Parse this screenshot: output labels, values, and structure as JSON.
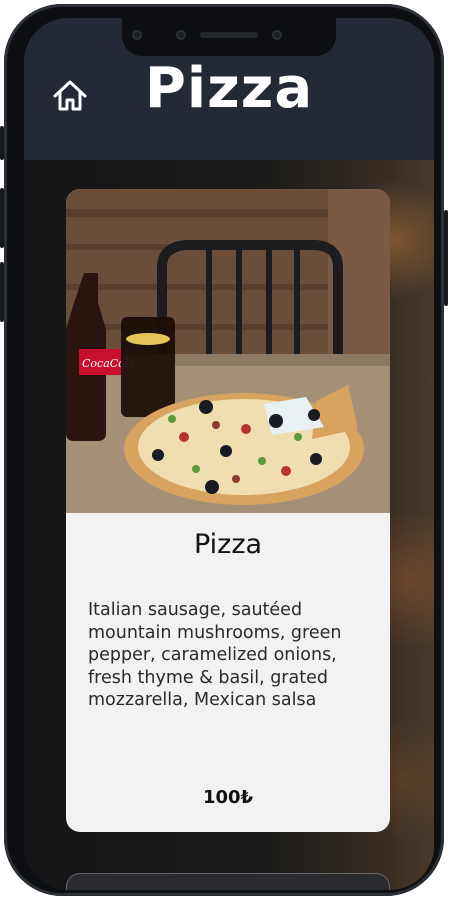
{
  "header": {
    "title": "Pizza"
  },
  "icons": {
    "home": "home-icon"
  },
  "product": {
    "name": "Pizza",
    "description": "Italian sausage, sautéed mountain mushrooms, green pepper, caramelized onions, fresh thyme & basil, grated mozzarella, Mexican salsa",
    "price": "100₺"
  },
  "colors": {
    "header_bg": "#232a35",
    "card_bg": "#f2f2f3",
    "title_text": "#ffffff"
  }
}
